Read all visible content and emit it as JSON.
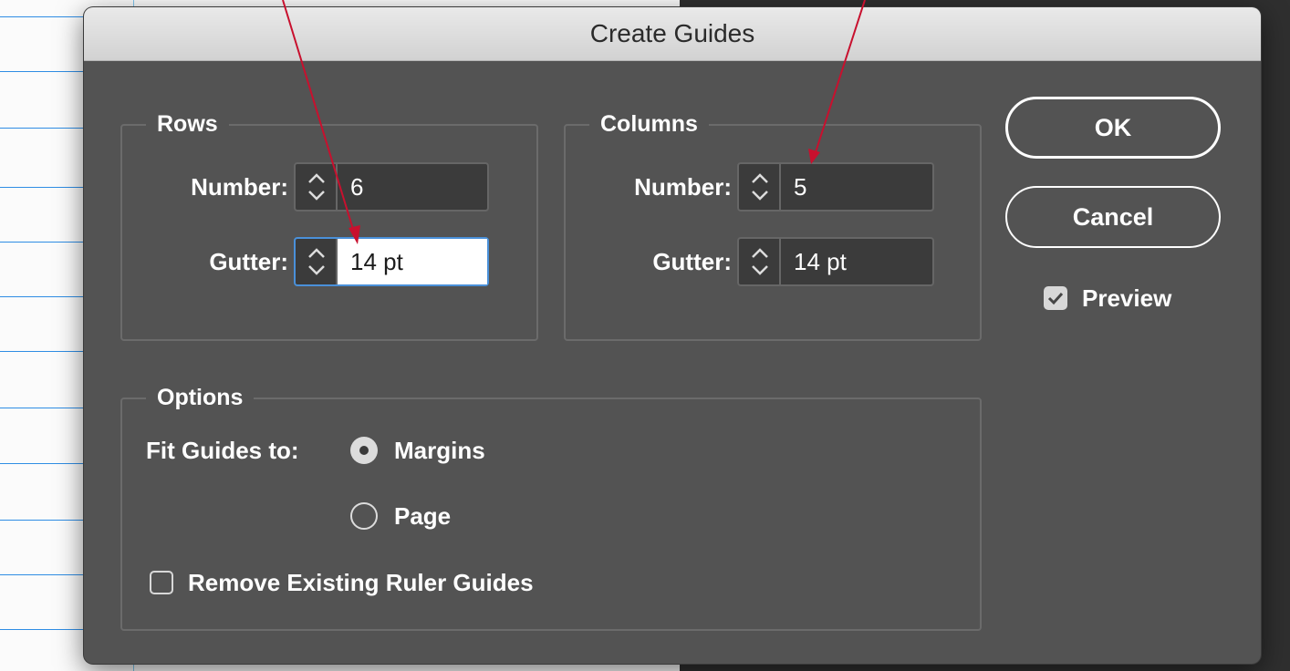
{
  "dialog": {
    "title": "Create Guides"
  },
  "rows": {
    "label": "Rows",
    "number_label": "Number:",
    "number_value": "6",
    "gutter_label": "Gutter:",
    "gutter_value": "14 pt"
  },
  "columns": {
    "label": "Columns",
    "number_label": "Number:",
    "number_value": "5",
    "gutter_label": "Gutter:",
    "gutter_value": "14 pt"
  },
  "buttons": {
    "ok": "OK",
    "cancel": "Cancel"
  },
  "preview": {
    "label": "Preview",
    "checked": true
  },
  "options": {
    "label": "Options",
    "fit_label": "Fit Guides to:",
    "fit_options": [
      {
        "label": "Margins",
        "selected": true
      },
      {
        "label": "Page",
        "selected": false
      }
    ],
    "remove_guides_label": "Remove Existing Ruler Guides",
    "remove_guides_checked": false
  },
  "colors": {
    "dialog_bg": "#535353",
    "titlebar": "#dcdcdc",
    "guide_line": "#2f8de4",
    "annotation_arrow": "#c8102e",
    "focus_ring": "#4a90d9"
  }
}
